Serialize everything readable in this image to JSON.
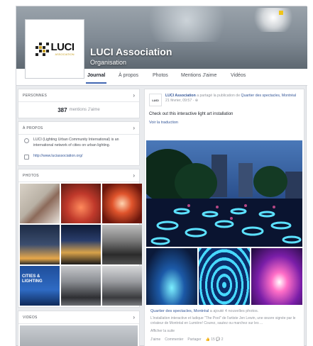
{
  "page": {
    "name": "LUCI Association",
    "category": "Organisation"
  },
  "logo": {
    "text": "LUCI",
    "sub": "ASSOCIATION"
  },
  "tabs": [
    {
      "label": "Journal",
      "active": true
    },
    {
      "label": "À propos"
    },
    {
      "label": "Photos"
    },
    {
      "label": "Mentions J'aime"
    },
    {
      "label": "Vidéos"
    }
  ],
  "sidebar": {
    "likes": {
      "heading": "PERSONNES",
      "count": "387",
      "label": "mentions J'aime"
    },
    "about": {
      "heading": "À PROPOS",
      "description": "LUCI (Lighting Urban Community International) is an international network of cities on urban lighting.",
      "website": "http://www.luciassociation.org/"
    },
    "photos": {
      "heading": "PHOTOS",
      "cities_tile": "CITIES & LIGHTING"
    },
    "videos": {
      "heading": "VIDÉOS"
    }
  },
  "post": {
    "author": "LUCI Association",
    "action": "a partagé la publication de",
    "shared_from": "Quartier des spectacles, Montréal",
    "timestamp": "21 février, 09:57 · ⊕",
    "text": "Check out this interactive light art installation",
    "see_translation": "Voir la traduction",
    "shared_author": "Quartier des spectacles, Montréal",
    "shared_action": "a ajouté 4 nouvelles photos.",
    "shared_description": "L'installation interactive et ludique \"The Pool\" de l'artiste Jen Lewin, une œuvre signée par le créateur de Montréal en Lumière! Courez, sautez ou marchez sur les ...",
    "translate_label": "Afficher la suite",
    "actions": [
      "J'aime",
      "Commenter",
      "Partager"
    ],
    "reactions": "👍 15  💬 2"
  },
  "colors": {
    "facebook_blue": "#4267b2",
    "link": "#365899",
    "muted": "#90949c"
  }
}
